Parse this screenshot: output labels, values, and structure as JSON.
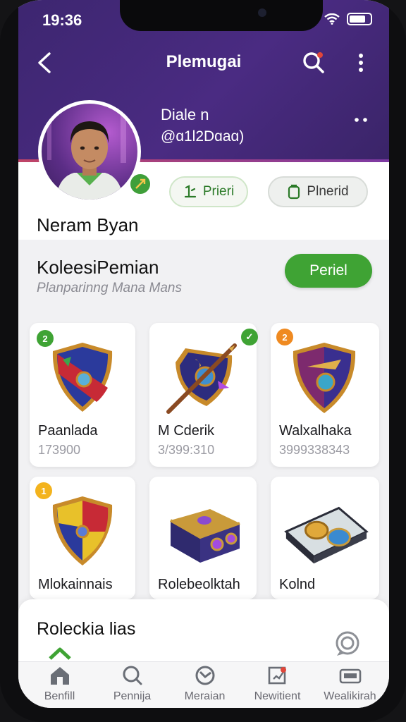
{
  "status_bar": {
    "time": "19:36"
  },
  "header": {
    "title": "Plemugai"
  },
  "profile": {
    "display_name": "Diale n",
    "handle": "@ɑ1l2Dɑaɑ)",
    "user_name": "Neram Byan",
    "action_1_label": "Prieri",
    "action_2_label": "Plnerid"
  },
  "collection": {
    "title": "KoleesiPemian",
    "subtitle": "Planparinng Mana Mans",
    "button_label": "Periel",
    "items": [
      {
        "name": "Paanlada",
        "number": "173900",
        "badge": "2",
        "badge_color": "#3fa334"
      },
      {
        "name": "M Cderik",
        "number": "3/399:310",
        "badge": "✓",
        "badge_color": "#3fa334"
      },
      {
        "name": "Walxalhaka",
        "number": "3999338343",
        "badge": "2",
        "badge_color": "#ef8a21"
      },
      {
        "name": "Mlokainnais",
        "number": "",
        "badge": "1",
        "badge_color": "#f3b31d"
      },
      {
        "name": "Rolebeolktah",
        "number": "",
        "badge": "",
        "badge_color": ""
      },
      {
        "name": "Kolnd",
        "number": "",
        "badge": "",
        "badge_color": ""
      }
    ]
  },
  "sheet": {
    "title": "Roleckia lias"
  },
  "tabs": [
    {
      "label": "Benfill",
      "icon": "home-icon"
    },
    {
      "label": "Pennija",
      "icon": "search-icon"
    },
    {
      "label": "Meraian",
      "icon": "compass-icon"
    },
    {
      "label": "Newitient",
      "icon": "edit-icon"
    },
    {
      "label": "Wealikirah",
      "icon": "card-icon"
    }
  ],
  "colors": {
    "header_purple": "#45297a",
    "accent_green": "#3fa334",
    "badge_orange": "#ef8a21",
    "badge_yellow": "#f3b31d"
  }
}
